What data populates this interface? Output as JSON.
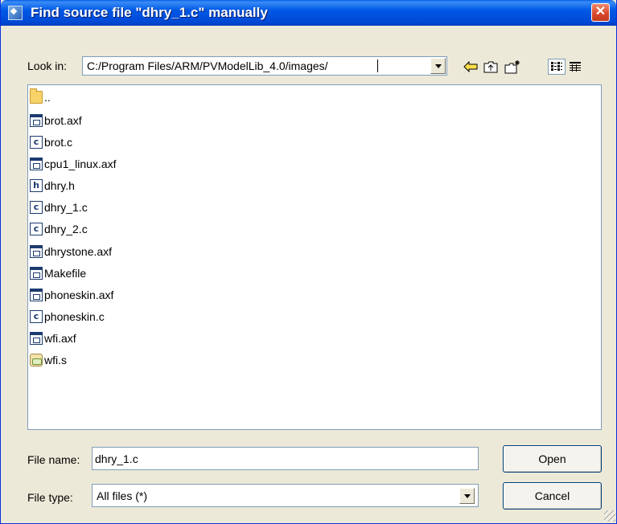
{
  "window": {
    "title": "Find source file \"dhry_1.c\" manually",
    "close_symbol": "✕"
  },
  "look_in": {
    "label": "Look in:",
    "path": "C:/Program Files/ARM/PVModelLib_4.0/images/"
  },
  "toolbar": {
    "icons": [
      "back-arrow-icon",
      "up-folder-icon",
      "new-folder-icon",
      "list-view-icon",
      "details-view-icon"
    ]
  },
  "files": [
    {
      "name": "..",
      "icon": "folder-icon"
    },
    {
      "name": "brot.axf",
      "icon": "executable-file-icon"
    },
    {
      "name": "brot.c",
      "icon": "c-source-file-icon"
    },
    {
      "name": "cpu1_linux.axf",
      "icon": "executable-file-icon"
    },
    {
      "name": "dhry.h",
      "icon": "header-file-icon"
    },
    {
      "name": "dhry_1.c",
      "icon": "c-source-file-icon"
    },
    {
      "name": "dhry_2.c",
      "icon": "c-source-file-icon"
    },
    {
      "name": "dhrystone.axf",
      "icon": "executable-file-icon"
    },
    {
      "name": "Makefile",
      "icon": "executable-file-icon"
    },
    {
      "name": "phoneskin.axf",
      "icon": "executable-file-icon"
    },
    {
      "name": "phoneskin.c",
      "icon": "c-source-file-icon"
    },
    {
      "name": "wfi.axf",
      "icon": "executable-file-icon"
    },
    {
      "name": "wfi.s",
      "icon": "assembly-file-icon"
    }
  ],
  "file_name": {
    "label": "File name:",
    "value": "dhry_1.c"
  },
  "file_type": {
    "label": "File type:",
    "value": "All files (*)"
  },
  "buttons": {
    "open": "Open",
    "cancel": "Cancel"
  },
  "colors": {
    "title_bar": "#0058e6",
    "close_button": "#d8452a",
    "dialog_bg": "#ece9d8"
  }
}
